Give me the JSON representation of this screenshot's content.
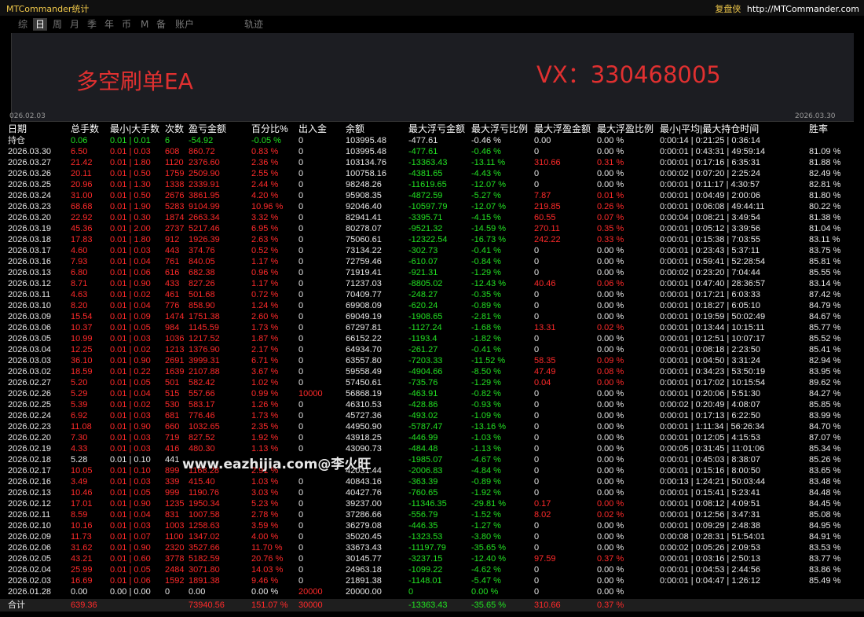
{
  "app": {
    "title": "MTCommander统计",
    "brand_name": "复盘侠",
    "brand_url": "http://MTCommander.com"
  },
  "tabs": [
    {
      "label": "综",
      "active": false
    },
    {
      "label": "日",
      "active": true
    },
    {
      "label": "周",
      "active": false
    },
    {
      "label": "月",
      "active": false
    },
    {
      "label": "季",
      "active": false
    },
    {
      "label": "年",
      "active": false
    },
    {
      "label": "币",
      "active": false
    },
    {
      "label": "M",
      "active": false
    },
    {
      "label": "备",
      "active": false
    },
    {
      "label": "账户",
      "active": false
    },
    {
      "label": "轨迹",
      "active": false
    }
  ],
  "chart": {
    "overlay_left": "多空刷单EA",
    "overlay_right": "VX：330468005",
    "start_date": "026.02.03",
    "end_date": "2026.03.30",
    "line_color": "#27b4ea"
  },
  "watermark": "www.eazhijia.com@李火旺",
  "colors": {
    "profit": "#ff2a2a",
    "loss": "#22e022",
    "neutral": "#e8e8e8"
  },
  "table": {
    "headers": [
      "日期",
      "总手数",
      "最小|大手数",
      "次数",
      "盈亏金额",
      "百分比%",
      "出入金",
      "余额",
      "最大浮亏金额",
      "最大浮亏比例",
      "最大浮盈金额",
      "最大浮盈比例",
      "最小|平均|最大持仓时间",
      "胜率"
    ],
    "holding": {
      "cells": [
        "持仓",
        "0.06",
        "0.01 | 0.01",
        "6",
        "-54.92",
        "-0.05 %",
        "0",
        "103995.48",
        "-477.61",
        "-0.46 %",
        "0.00",
        "0.00 %",
        "0:00:14 | 0:21:25 | 0:36:14",
        ""
      ],
      "color": "green"
    },
    "rows": [
      [
        "2026.03.30",
        "6.50",
        "0.01 | 0.03",
        "608",
        "860.72",
        "0.83 %",
        "0",
        "103995.48",
        "-477.61",
        "-0.46 %",
        "0",
        "0.00 %",
        "0:00:01 | 0:43:31 | 49:59:14",
        "81.09 %"
      ],
      [
        "2026.03.27",
        "21.42",
        "0.01 | 1.80",
        "1120",
        "2376.60",
        "2.36 %",
        "0",
        "103134.76",
        "-13363.43",
        "-13.11 %",
        "310.66",
        "0.31 %",
        "0:00:01 | 0:17:16 | 6:35:31",
        "81.88 %"
      ],
      [
        "2026.03.26",
        "20.11",
        "0.01 | 0.50",
        "1759",
        "2509.90",
        "2.55 %",
        "0",
        "100758.16",
        "-4381.65",
        "-4.43 %",
        "0",
        "0.00 %",
        "0:00:02 | 0:07:20 | 2:25:24",
        "82.49 %"
      ],
      [
        "2026.03.25",
        "20.96",
        "0.01 | 1.30",
        "1338",
        "2339.91",
        "2.44 %",
        "0",
        "98248.26",
        "-11619.65",
        "-12.07 %",
        "0",
        "0.00 %",
        "0:00:01 | 0:11:17 | 4:30:57",
        "82.81 %"
      ],
      [
        "2026.03.24",
        "31.00",
        "0.01 | 0.50",
        "2676",
        "3861.95",
        "4.20 %",
        "0",
        "95908.35",
        "-4872.59",
        "-5.27 %",
        "7.87",
        "0.01 %",
        "0:00:01 | 0:04:49 | 2:00:06",
        "81.80 %"
      ],
      [
        "2026.03.23",
        "68.68",
        "0.01 | 1.90",
        "5283",
        "9104.99",
        "10.96 %",
        "0",
        "92046.40",
        "-10597.79",
        "-12.07 %",
        "219.85",
        "0.26 %",
        "0:00:01 | 0:06:08 | 49:44:11",
        "80.22 %"
      ],
      [
        "2026.03.20",
        "22.92",
        "0.01 | 0.30",
        "1874",
        "2663.34",
        "3.32 %",
        "0",
        "82941.41",
        "-3395.71",
        "-4.15 %",
        "60.55",
        "0.07 %",
        "0:00:04 | 0:08:21 | 3:49:54",
        "81.38 %"
      ],
      [
        "2026.03.19",
        "45.36",
        "0.01 | 2.00",
        "2737",
        "5217.46",
        "6.95 %",
        "0",
        "80278.07",
        "-9521.32",
        "-14.59 %",
        "270.11",
        "0.35 %",
        "0:00:01 | 0:05:12 | 3:39:56",
        "81.04 %"
      ],
      [
        "2026.03.18",
        "17.83",
        "0.01 | 1.80",
        "912",
        "1926.39",
        "2.63 %",
        "0",
        "75060.61",
        "-12322.54",
        "-16.73 %",
        "242.22",
        "0.33 %",
        "0:00:01 | 0:15:38 | 7:03:55",
        "83.11 %"
      ],
      [
        "2026.03.17",
        "4.60",
        "0.01 | 0.03",
        "443",
        "374.76",
        "0.52 %",
        "0",
        "73134.22",
        "-302.73",
        "-0.41 %",
        "0",
        "0.00 %",
        "0:00:01 | 0:23:43 | 5:37:11",
        "83.75 %"
      ],
      [
        "2026.03.16",
        "7.93",
        "0.01 | 0.04",
        "761",
        "840.05",
        "1.17 %",
        "0",
        "72759.46",
        "-610.07",
        "-0.84 %",
        "0",
        "0.00 %",
        "0:00:01 | 0:59:41 | 52:28:54",
        "85.81 %"
      ],
      [
        "2026.03.13",
        "6.80",
        "0.01 | 0.06",
        "616",
        "682.38",
        "0.96 %",
        "0",
        "71919.41",
        "-921.31",
        "-1.29 %",
        "0",
        "0.00 %",
        "0:00:02 | 0:23:20 | 7:04:44",
        "85.55 %"
      ],
      [
        "2026.03.12",
        "8.71",
        "0.01 | 0.90",
        "433",
        "827.26",
        "1.17 %",
        "0",
        "71237.03",
        "-8805.02",
        "-12.43 %",
        "40.46",
        "0.06 %",
        "0:00:01 | 0:47:40 | 28:36:57",
        "83.14 %"
      ],
      [
        "2026.03.11",
        "4.63",
        "0.01 | 0.02",
        "461",
        "501.68",
        "0.72 %",
        "0",
        "70409.77",
        "-248.27",
        "-0.35 %",
        "0",
        "0.00 %",
        "0:00:01 | 0:17:21 | 6:03:33",
        "87.42 %"
      ],
      [
        "2026.03.10",
        "8.20",
        "0.01 | 0.04",
        "776",
        "858.90",
        "1.24 %",
        "0",
        "69908.09",
        "-620.24",
        "-0.89 %",
        "0",
        "0.00 %",
        "0:00:01 | 0:18:27 | 6:05:10",
        "84.79 %"
      ],
      [
        "2026.03.09",
        "15.54",
        "0.01 | 0.09",
        "1474",
        "1751.38",
        "2.60 %",
        "0",
        "69049.19",
        "-1908.65",
        "-2.81 %",
        "0",
        "0.00 %",
        "0:00:01 | 0:19:59 | 50:02:49",
        "84.67 %"
      ],
      [
        "2026.03.06",
        "10.37",
        "0.01 | 0.05",
        "984",
        "1145.59",
        "1.73 %",
        "0",
        "67297.81",
        "-1127.24",
        "-1.68 %",
        "13.31",
        "0.02 %",
        "0:00:01 | 0:13:44 | 10:15:11",
        "85.77 %"
      ],
      [
        "2026.03.05",
        "10.99",
        "0.01 | 0.03",
        "1036",
        "1217.52",
        "1.87 %",
        "0",
        "66152.22",
        "-1193.4",
        "-1.82 %",
        "0",
        "0.00 %",
        "0:00:01 | 0:12:51 | 10:07:17",
        "85.52 %"
      ],
      [
        "2026.03.04",
        "12.25",
        "0.01 | 0.02",
        "1213",
        "1376.90",
        "2.17 %",
        "0",
        "64934.70",
        "-261.27",
        "-0.41 %",
        "0",
        "0.00 %",
        "0:00:01 | 0:08:18 | 2:23:50",
        "85.41 %"
      ],
      [
        "2026.03.03",
        "36.10",
        "0.01 | 0.90",
        "2691",
        "3999.31",
        "6.71 %",
        "0",
        "63557.80",
        "-7203.33",
        "-11.52 %",
        "58.35",
        "0.09 %",
        "0:00:01 | 0:04:50 | 3:31:24",
        "82.94 %"
      ],
      [
        "2026.03.02",
        "18.59",
        "0.01 | 0.22",
        "1639",
        "2107.88",
        "3.67 %",
        "0",
        "59558.49",
        "-4904.66",
        "-8.50 %",
        "47.49",
        "0.08 %",
        "0:00:01 | 0:34:23 | 53:50:19",
        "83.95 %"
      ],
      [
        "2026.02.27",
        "5.20",
        "0.01 | 0.05",
        "501",
        "582.42",
        "1.02 %",
        "0",
        "57450.61",
        "-735.76",
        "-1.29 %",
        "0.04",
        "0.00 %",
        "0:00:01 | 0:17:02 | 10:15:54",
        "89.62 %"
      ],
      [
        "2026.02.26",
        "5.29",
        "0.01 | 0.04",
        "515",
        "557.66",
        "0.99 %",
        "10000",
        "56868.19",
        "-463.91",
        "-0.82 %",
        "0",
        "0.00 %",
        "0:00:01 | 0:20:06 | 5:51:30",
        "84.27 %"
      ],
      [
        "2026.02.25",
        "5.39",
        "0.01 | 0.02",
        "530",
        "583.17",
        "1.26 %",
        "0",
        "46310.53",
        "-428.86",
        "-0.93 %",
        "0",
        "0.00 %",
        "0:00:02 | 0:20:49 | 4:08:07",
        "85.85 %"
      ],
      [
        "2026.02.24",
        "6.92",
        "0.01 | 0.03",
        "681",
        "776.46",
        "1.73 %",
        "0",
        "45727.36",
        "-493.02",
        "-1.09 %",
        "0",
        "0.00 %",
        "0:00:01 | 0:17:13 | 6:22:50",
        "83.99 %"
      ],
      [
        "2026.02.23",
        "11.08",
        "0.01 | 0.90",
        "660",
        "1032.65",
        "2.35 %",
        "0",
        "44950.90",
        "-5787.47",
        "-13.16 %",
        "0",
        "0.00 %",
        "0:00:01 | 1:11:34 | 56:26:34",
        "84.70 %"
      ],
      [
        "2026.02.20",
        "7.30",
        "0.01 | 0.03",
        "719",
        "827.52",
        "1.92 %",
        "0",
        "43918.25",
        "-446.99",
        "-1.03 %",
        "0",
        "0.00 %",
        "0:00:01 | 0:12:05 | 4:15:53",
        "87.07 %"
      ],
      [
        "2026.02.19",
        "4.33",
        "0.01 | 0.03",
        "416",
        "480.30",
        "1.13 %",
        "0",
        "43090.73",
        "-484.48",
        "-1.13 %",
        "0",
        "0.00 %",
        "0:00:05 | 0:31:45 | 11:01:06",
        "85.34 %"
      ],
      [
        "2026.02.18",
        "5.28",
        "0.01 | 0.10",
        "441",
        "",
        "",
        "",
        "",
        "-1985.07",
        "-4.67 %",
        "0",
        "0.00 %",
        "0:00:01 | 0:45:03 | 8:38:07",
        "85.26 %"
      ],
      [
        "2026.02.17",
        "10.05",
        "0.01 | 0.10",
        "899",
        "1168.28",
        "2.91 %",
        "",
        "42031.44",
        "-2006.83",
        "-4.84 %",
        "0",
        "0.00 %",
        "0:00:01 | 0:15:16 | 8:00:50",
        "83.65 %"
      ],
      [
        "2026.02.16",
        "3.49",
        "0.01 | 0.03",
        "339",
        "415.40",
        "1.03 %",
        "0",
        "40843.16",
        "-363.39",
        "-0.89 %",
        "0",
        "0.00 %",
        "0:00:13 | 1:24:21 | 50:03:44",
        "83.48 %"
      ],
      [
        "2026.02.13",
        "10.46",
        "0.01 | 0.05",
        "999",
        "1190.76",
        "3.03 %",
        "0",
        "40427.76",
        "-760.65",
        "-1.92 %",
        "0",
        "0.00 %",
        "0:00:01 | 0:15:41 | 5:23:41",
        "84.48 %"
      ],
      [
        "2026.02.12",
        "17.01",
        "0.01 | 0.90",
        "1235",
        "1950.34",
        "5.23 %",
        "0",
        "39237.00",
        "-11346.35",
        "-29.81 %",
        "0.17",
        "0.00 %",
        "0:00:01 | 0:08:12 | 4:09:51",
        "84.45 %"
      ],
      [
        "2026.02.11",
        "8.59",
        "0.01 | 0.04",
        "831",
        "1007.58",
        "2.78 %",
        "0",
        "37286.66",
        "-556.79",
        "-1.52 %",
        "8.02",
        "0.02 %",
        "0:00:01 | 0:12:56 | 3:47:31",
        "85.08 %"
      ],
      [
        "2026.02.10",
        "10.16",
        "0.01 | 0.03",
        "1003",
        "1258.63",
        "3.59 %",
        "0",
        "36279.08",
        "-446.35",
        "-1.27 %",
        "0",
        "0.00 %",
        "0:00:01 | 0:09:29 | 2:48:38",
        "84.95 %"
      ],
      [
        "2026.02.09",
        "11.73",
        "0.01 | 0.07",
        "1100",
        "1347.02",
        "4.00 %",
        "0",
        "35020.45",
        "-1323.53",
        "-3.80 %",
        "0",
        "0.00 %",
        "0:00:08 | 0:28:31 | 51:54:01",
        "84.91 %"
      ],
      [
        "2026.02.06",
        "31.62",
        "0.01 | 0.90",
        "2320",
        "3527.66",
        "11.70 %",
        "0",
        "33673.43",
        "-11197.79",
        "-35.65 %",
        "0",
        "0.00 %",
        "0:00:02 | 0:05:26 | 2:09:53",
        "83.53 %"
      ],
      [
        "2026.02.05",
        "43.21",
        "0.01 | 0.60",
        "3778",
        "5182.59",
        "20.76 %",
        "0",
        "30145.77",
        "-3237.15",
        "-12.40 %",
        "97.59",
        "0.37 %",
        "0:00:01 | 0:03:16 | 2:50:13",
        "83.77 %"
      ],
      [
        "2026.02.04",
        "25.99",
        "0.01 | 0.05",
        "2484",
        "3071.80",
        "14.03 %",
        "0",
        "24963.18",
        "-1099.22",
        "-4.62 %",
        "0",
        "0.00 %",
        "0:00:01 | 0:04:53 | 2:44:56",
        "83.86 %"
      ],
      [
        "2026.02.03",
        "16.69",
        "0.01 | 0.06",
        "1592",
        "1891.38",
        "9.46 %",
        "0",
        "21891.38",
        "-1148.01",
        "-5.47 %",
        "0",
        "0.00 %",
        "0:00:01 | 0:04:47 | 1:26:12",
        "85.49 %"
      ],
      [
        "2026.01.28",
        "0.00",
        "0.00 | 0.00",
        "0",
        "0.00",
        "0.00 %",
        "20000",
        "20000.00",
        "0",
        "0.00 %",
        "0",
        "0.00 %",
        "",
        ""
      ]
    ],
    "total": [
      "合计",
      "639.36",
      "",
      "",
      "73940.56",
      "151.07 %",
      "30000",
      "",
      "-13363.43",
      "-35.65 %",
      "310.66",
      "0.37 %",
      "",
      ""
    ]
  }
}
